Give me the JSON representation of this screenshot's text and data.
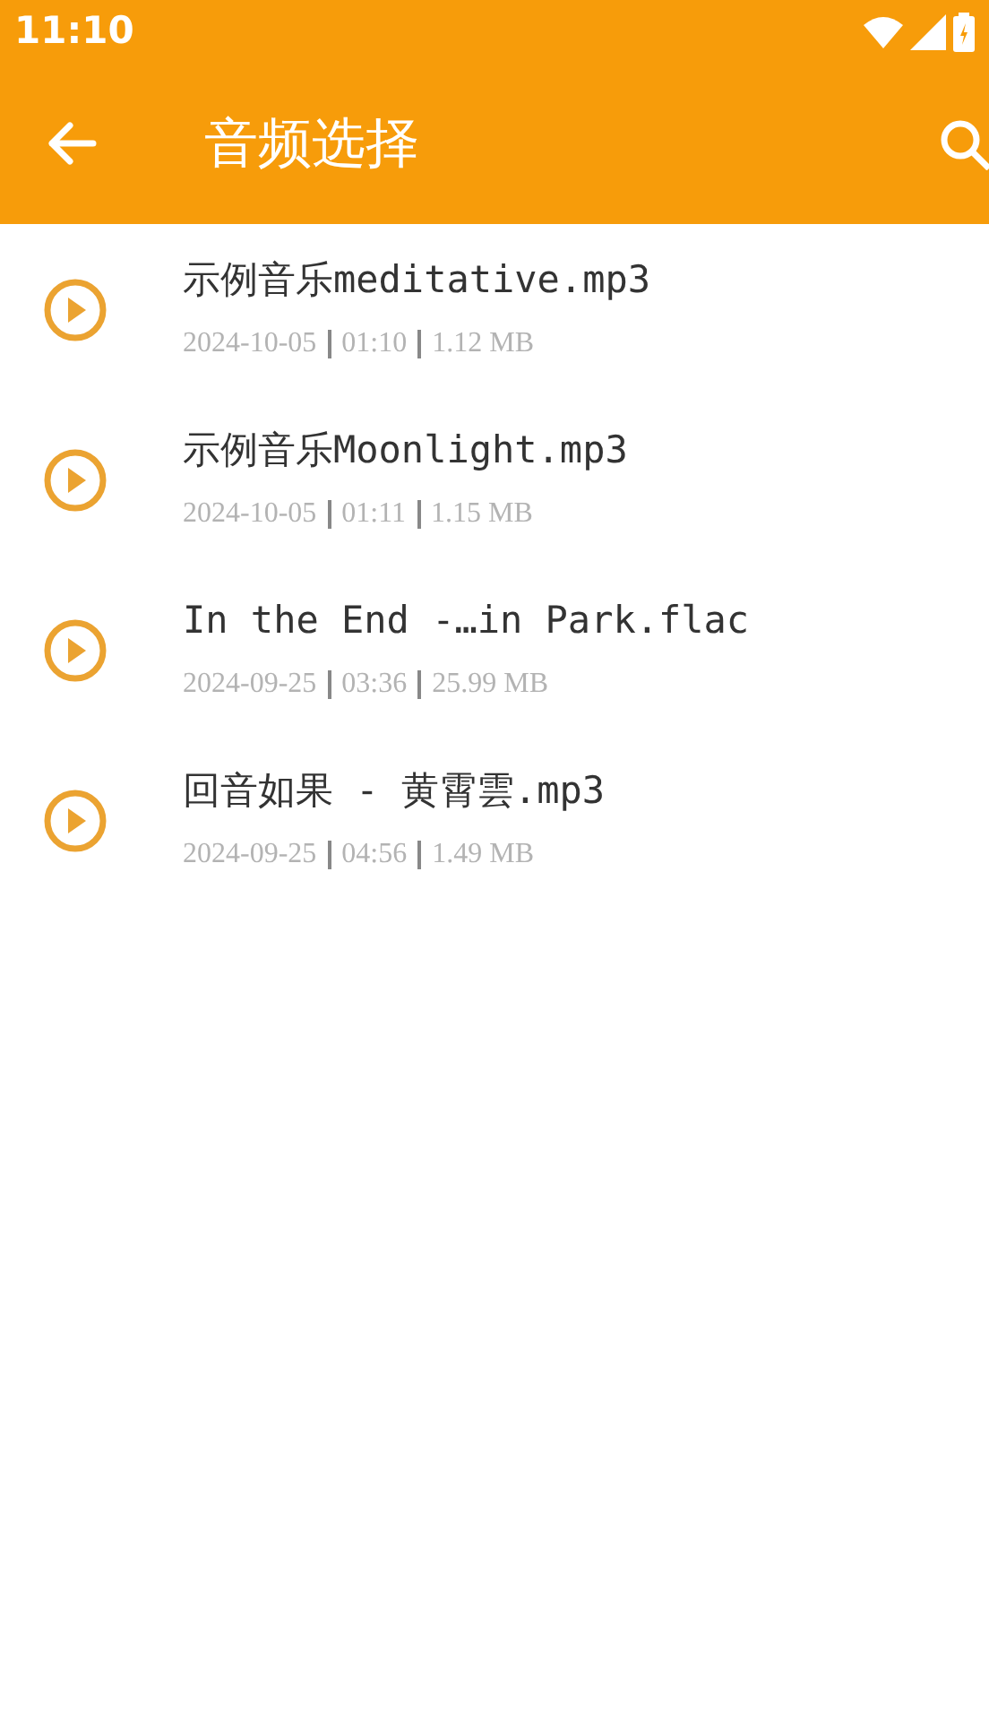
{
  "status_bar": {
    "time": "11:10"
  },
  "toolbar": {
    "title": "音频选择"
  },
  "files": [
    {
      "name": "示例音乐meditative.mp3",
      "date": "2024-10-05",
      "duration": "01:10",
      "size": "1.12 MB"
    },
    {
      "name": "示例音乐Moonlight.mp3",
      "date": "2024-10-05",
      "duration": "01:11",
      "size": "1.15 MB"
    },
    {
      "name": "In the End -…in Park.flac",
      "date": "2024-09-25",
      "duration": "03:36",
      "size": "25.99 MB"
    },
    {
      "name": "回音如果 - 黄霄雲.mp3",
      "date": "2024-09-25",
      "duration": "04:56",
      "size": "1.49 MB"
    }
  ]
}
